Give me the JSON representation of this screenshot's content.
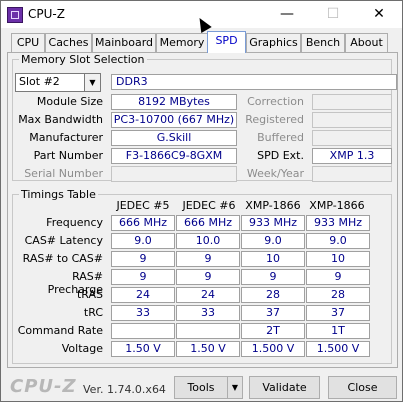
{
  "window": {
    "title": "CPU-Z",
    "minimize": "—",
    "maximize": "☐",
    "close": "✕"
  },
  "tabs": [
    {
      "label": "CPU"
    },
    {
      "label": "Caches"
    },
    {
      "label": "Mainboard"
    },
    {
      "label": "Memory"
    },
    {
      "label": "SPD"
    },
    {
      "label": "Graphics"
    },
    {
      "label": "Bench"
    },
    {
      "label": "About"
    }
  ],
  "memory_slot": {
    "title": "Memory Slot Selection",
    "slot_selected": "Slot #2",
    "type": "DDR3",
    "module_size_label": "Module Size",
    "module_size": "8192 MBytes",
    "max_bandwidth_label": "Max Bandwidth",
    "max_bandwidth": "PC3-10700 (667 MHz)",
    "manufacturer_label": "Manufacturer",
    "manufacturer": "G.Skill",
    "part_number_label": "Part Number",
    "part_number": "F3-1866C9-8GXM",
    "serial_number_label": "Serial Number",
    "serial_number": "",
    "correction_label": "Correction",
    "correction": "",
    "registered_label": "Registered",
    "registered": "",
    "buffered_label": "Buffered",
    "buffered": "",
    "spd_ext_label": "SPD Ext.",
    "spd_ext": "XMP 1.3",
    "week_year_label": "Week/Year",
    "week_year": ""
  },
  "timings": {
    "title": "Timings Table",
    "columns": [
      "JEDEC #5",
      "JEDEC #6",
      "XMP-1866",
      "XMP-1866"
    ],
    "rows": [
      {
        "label": "Frequency",
        "values": [
          "666 MHz",
          "666 MHz",
          "933 MHz",
          "933 MHz"
        ]
      },
      {
        "label": "CAS# Latency",
        "values": [
          "9.0",
          "10.0",
          "9.0",
          "9.0"
        ]
      },
      {
        "label": "RAS# to CAS#",
        "values": [
          "9",
          "9",
          "10",
          "10"
        ]
      },
      {
        "label": "RAS# Precharge",
        "values": [
          "9",
          "9",
          "9",
          "9"
        ]
      },
      {
        "label": "tRAS",
        "values": [
          "24",
          "24",
          "28",
          "28"
        ]
      },
      {
        "label": "tRC",
        "values": [
          "33",
          "33",
          "37",
          "37"
        ]
      },
      {
        "label": "Command Rate",
        "values": [
          "",
          "",
          "2T",
          "1T"
        ]
      },
      {
        "label": "Voltage",
        "values": [
          "1.50 V",
          "1.50 V",
          "1.500 V",
          "1.500 V"
        ]
      }
    ]
  },
  "footer": {
    "brand": "CPU-Z",
    "version": "Ver. 1.74.0.x64",
    "tools_label": "Tools",
    "tools_arrow": "▼",
    "validate_label": "Validate",
    "close_label": "Close"
  }
}
